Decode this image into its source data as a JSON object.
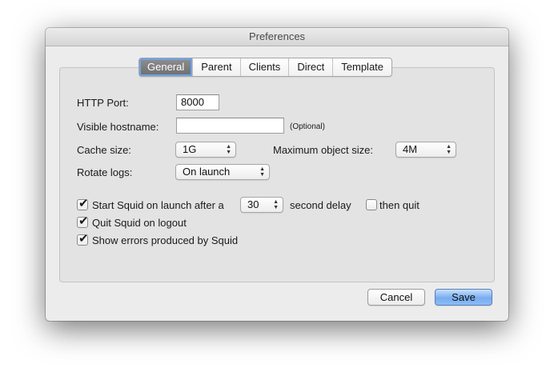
{
  "window": {
    "title": "Preferences"
  },
  "tabs": [
    {
      "label": "General",
      "selected": true
    },
    {
      "label": "Parent",
      "selected": false
    },
    {
      "label": "Clients",
      "selected": false
    },
    {
      "label": "Direct",
      "selected": false
    },
    {
      "label": "Template",
      "selected": false
    }
  ],
  "general": {
    "http_port": {
      "label": "HTTP Port:",
      "value": "8000"
    },
    "visible_hostname": {
      "label": "Visible hostname:",
      "value": "",
      "hint": "(Optional)"
    },
    "cache_size": {
      "label": "Cache size:",
      "value": "1G"
    },
    "max_object_size": {
      "label": "Maximum object size:",
      "value": "4M"
    },
    "rotate_logs": {
      "label": "Rotate logs:",
      "value": "On launch"
    },
    "start_on_launch": {
      "label": "Start Squid on launch after a",
      "checked": true,
      "delay_value": "30",
      "delay_suffix": "second delay"
    },
    "then_quit": {
      "label": "then quit",
      "checked": false
    },
    "quit_on_logout": {
      "label": "Quit Squid on logout",
      "checked": true
    },
    "show_errors": {
      "label": "Show errors produced by Squid",
      "checked": true
    }
  },
  "buttons": {
    "cancel": "Cancel",
    "save": "Save"
  },
  "colors": {
    "accent": "#76acf0",
    "selected_tab": "#7a7a7a",
    "window_bg": "#ececec"
  },
  "icons": {
    "checkmark": "✔",
    "popup_arrows": "▲▼"
  }
}
